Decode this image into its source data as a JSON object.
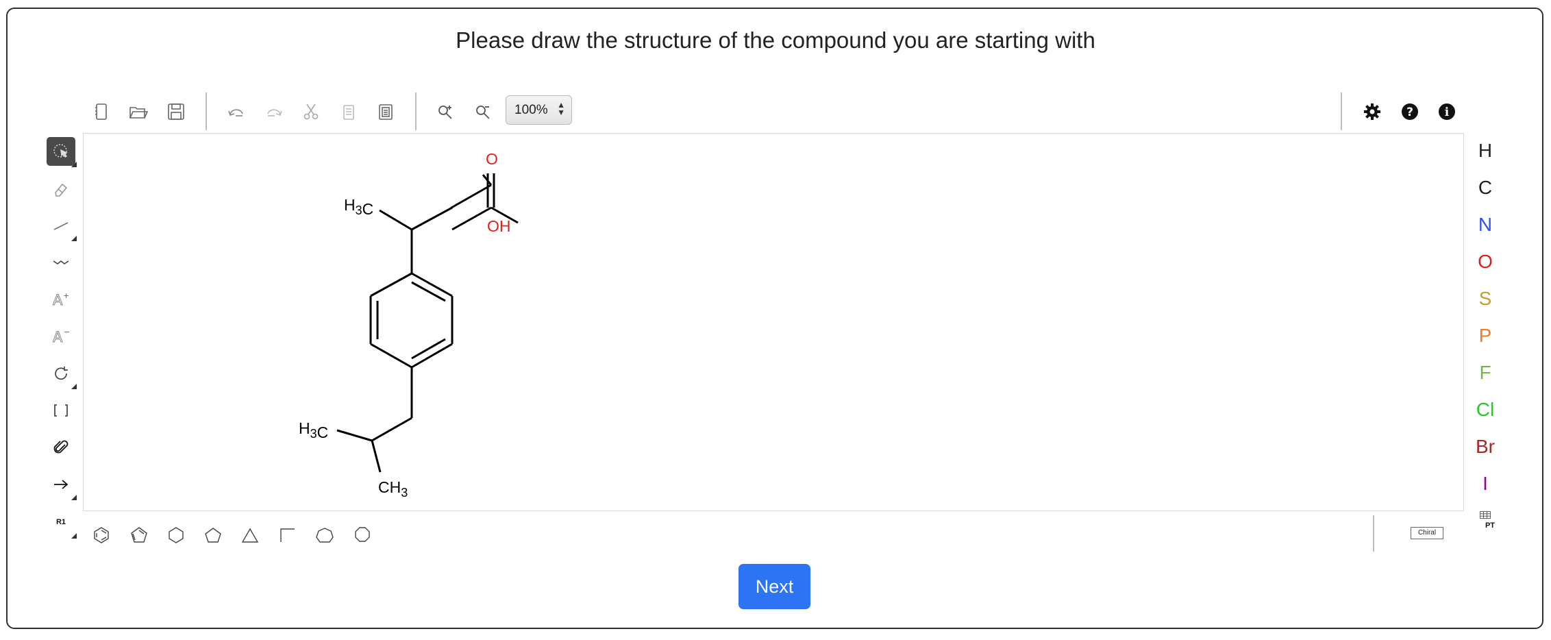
{
  "page": {
    "title": "Please draw the structure of the compound you are starting with",
    "next_label": "Next"
  },
  "toolbar": {
    "zoom_value": "100%",
    "top_icons": [
      "new-document-icon",
      "open-folder-icon",
      "save-icon",
      "undo-icon",
      "redo-icon",
      "cut-icon",
      "copy-icon",
      "paste-icon",
      "zoom-in-icon",
      "zoom-out-icon"
    ],
    "right_icons": [
      "settings-icon",
      "help-icon",
      "info-icon"
    ]
  },
  "left_tools": [
    "select-tool",
    "eraser-tool",
    "bond-tool",
    "chain-tool",
    "charge-plus-tool",
    "charge-minus-tool",
    "rotate-tool",
    "sgroup-bracket-tool",
    "reaction-mapping-tool",
    "reaction-arrow-tool",
    "rgroup-tool"
  ],
  "rgroup_label": "R1",
  "bottom_templates": [
    "benzene",
    "cyclopentadiene",
    "cyclohexane",
    "cyclopentane",
    "cyclopropane",
    "cyclobutane",
    "cycloheptane",
    "cyclooctane"
  ],
  "atoms": [
    {
      "symbol": "H",
      "color": "#000000"
    },
    {
      "symbol": "C",
      "color": "#000000"
    },
    {
      "symbol": "N",
      "color": "#304ff7"
    },
    {
      "symbol": "O",
      "color": "#e0201b"
    },
    {
      "symbol": "S",
      "color": "#c99a2e"
    },
    {
      "symbol": "P",
      "color": "#ef7c2e"
    },
    {
      "symbol": "F",
      "color": "#76b34a"
    },
    {
      "symbol": "Cl",
      "color": "#1fcc1f"
    },
    {
      "symbol": "Br",
      "color": "#a52a2a"
    },
    {
      "symbol": "I",
      "color": "#940094"
    }
  ],
  "periodic_table_label": "PT",
  "chiral_label": "Chiral",
  "molecule": {
    "labels": {
      "o_top": "O",
      "oh": "OH",
      "h3c_top": "H3C",
      "h3c_bottom": "H3C",
      "ch3_bottom": "CH3"
    }
  }
}
